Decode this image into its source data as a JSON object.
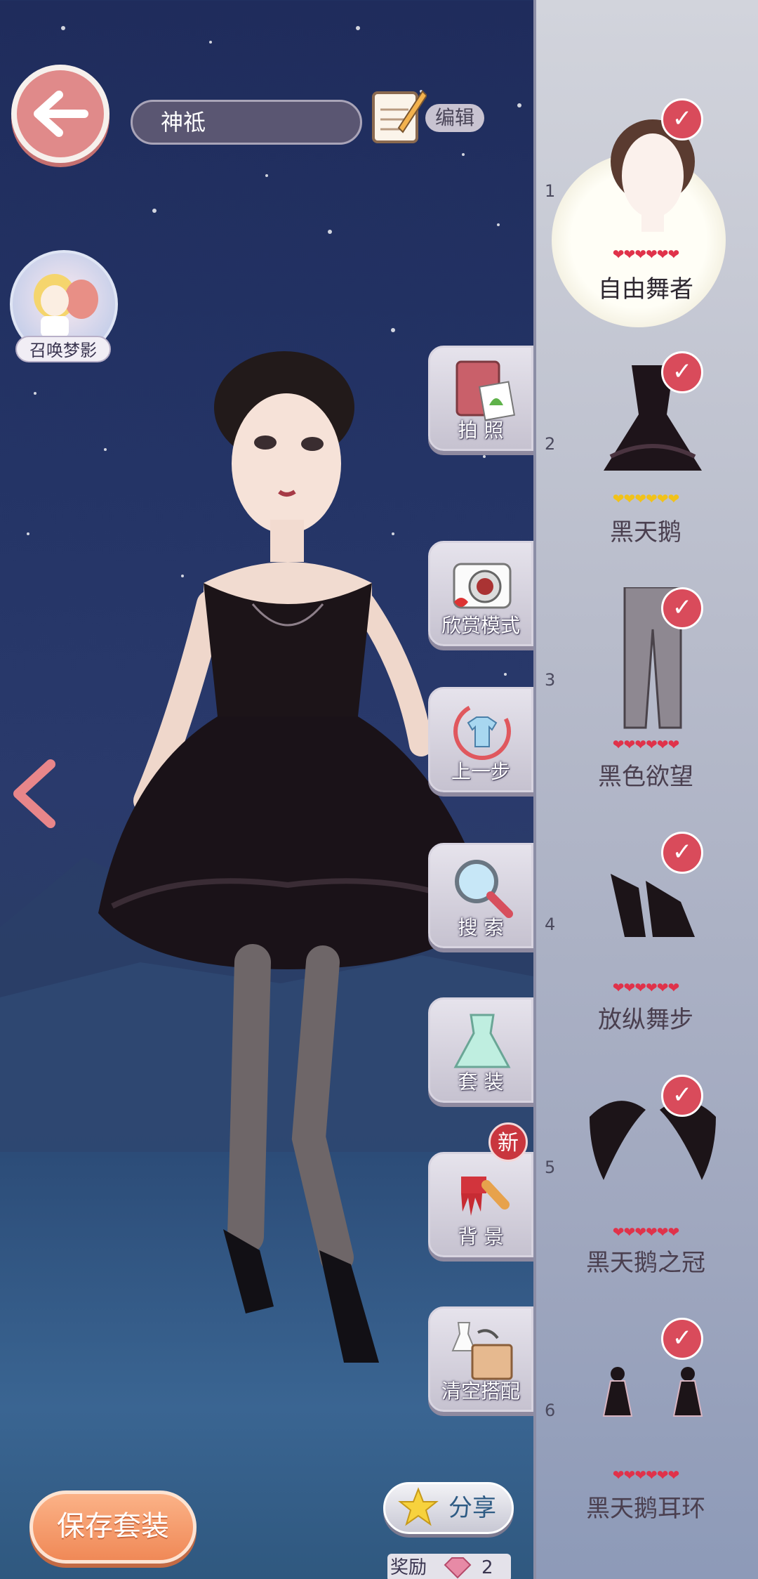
{
  "header": {
    "outfit_name": "神祗",
    "edit_label": "编辑"
  },
  "summon": {
    "label": "召唤梦影"
  },
  "tools": [
    {
      "label": "拍 照",
      "icon": "photo-album-icon"
    },
    {
      "label": "欣赏模式",
      "icon": "camera-icon"
    },
    {
      "label": "上一步",
      "icon": "undo-shirt-icon"
    },
    {
      "label": "搜 索",
      "icon": "magnifier-icon"
    },
    {
      "label": "套 装",
      "icon": "dress-icon"
    },
    {
      "label": "背 景",
      "icon": "paintbrush-icon",
      "badge": "新"
    },
    {
      "label": "清空搭配",
      "icon": "clear-box-icon"
    }
  ],
  "bottom": {
    "save_label": "保存套装",
    "share_label": "分享",
    "reward_label": "奖励",
    "reward_count": "2"
  },
  "items": [
    {
      "index": "1",
      "name": "自由舞者",
      "hearts": "❤❤❤❤❤❤",
      "heart_color": "red",
      "checked": true,
      "selected": true
    },
    {
      "index": "2",
      "name": "黑天鹅",
      "hearts": "❤❤❤❤❤❤",
      "heart_color": "gold",
      "checked": true
    },
    {
      "index": "3",
      "name": "黑色欲望",
      "hearts": "❤❤❤❤❤❤",
      "heart_color": "red",
      "checked": true
    },
    {
      "index": "4",
      "name": "放纵舞步",
      "hearts": "❤❤❤❤❤❤",
      "heart_color": "red",
      "checked": true
    },
    {
      "index": "5",
      "name": "黑天鹅之冠",
      "hearts": "❤❤❤❤❤❤",
      "heart_color": "red",
      "checked": true
    },
    {
      "index": "6",
      "name": "黑天鹅耳环",
      "hearts": "❤❤❤❤❤❤",
      "heart_color": "red",
      "checked": true
    }
  ],
  "colors": {
    "accent": "#d94b5b",
    "save": "#f08957",
    "panel": "#c2c5d2"
  }
}
